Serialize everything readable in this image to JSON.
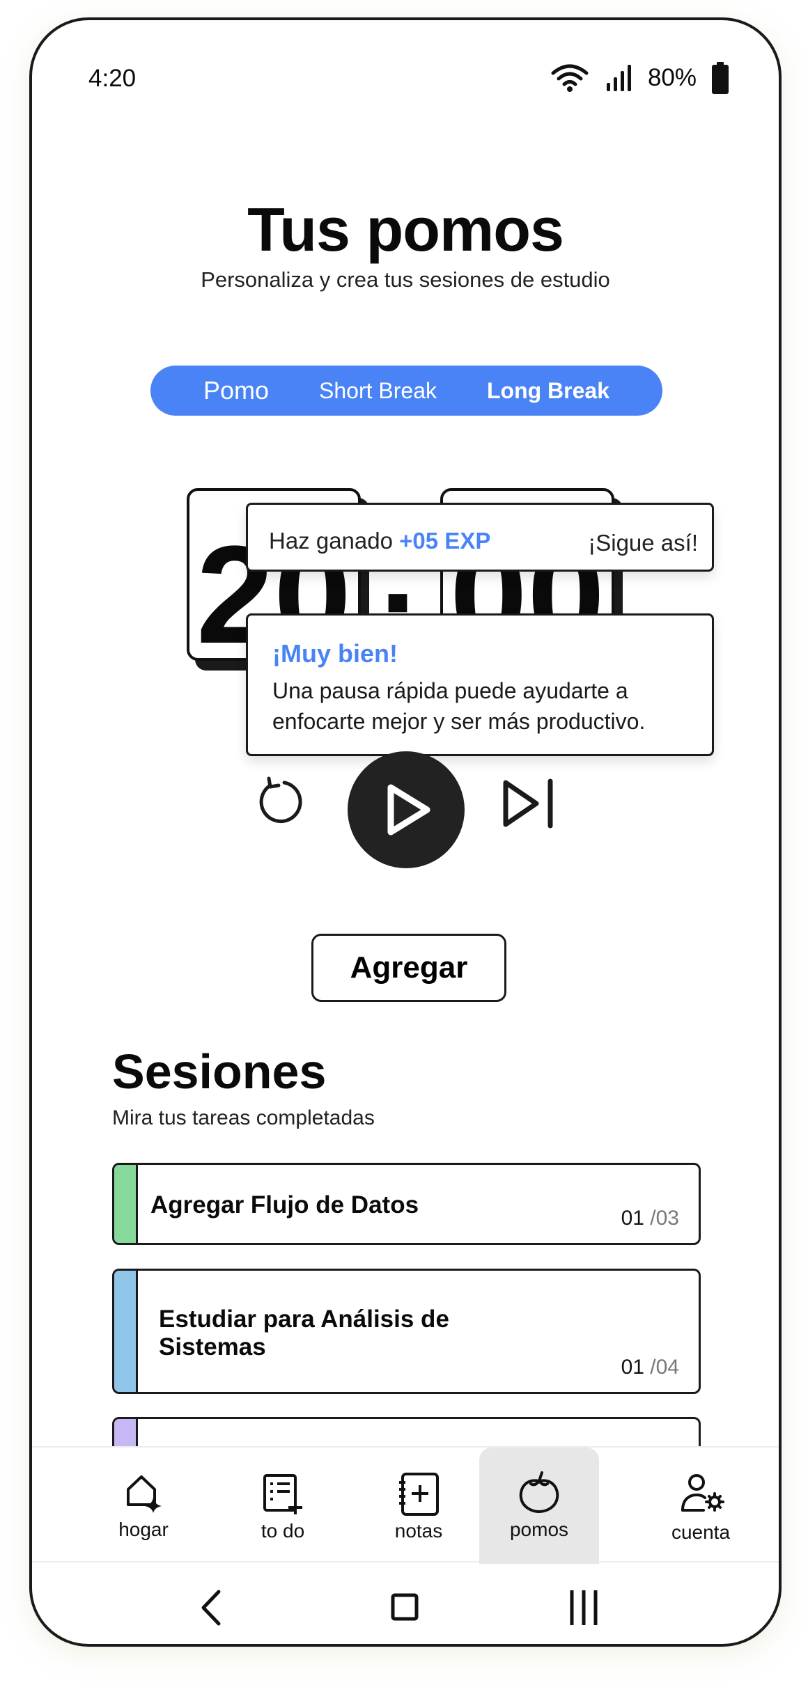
{
  "status_bar": {
    "time": "4:20",
    "battery": "80%"
  },
  "header": {
    "title": "Tus pomos",
    "subtitle": "Personaliza y crea tus sesiones de estudio"
  },
  "mode_tabs": [
    {
      "label": "Pomo"
    },
    {
      "label": "Short Break"
    },
    {
      "label": "Long Break"
    }
  ],
  "timer": {
    "minutes": "20",
    "seconds": "00",
    "separator": ":"
  },
  "toast_exp": {
    "lead": "Haz ganado",
    "exp": "+05 EXP",
    "cheer": "¡Sigue así!"
  },
  "toast_tip": {
    "title": "¡Muy bien!",
    "body": "Una pausa rápida puede ayudarte a enfocarte mejor y ser más productivo."
  },
  "add_button": {
    "label": "Agregar"
  },
  "sessions": {
    "title": "Sesiones",
    "subtitle": "Mira tus tareas completadas",
    "items": [
      {
        "name": "Agregar Flujo de Datos",
        "done": "01",
        "total": "/03",
        "color": "#86d99a"
      },
      {
        "name": "Estudiar para Análisis de Sistemas",
        "done": "01",
        "total": "/04",
        "color": "#8ec5e8"
      },
      {
        "name": "",
        "done": "",
        "total": "",
        "color": "#c7b8f5"
      }
    ]
  },
  "bottom_nav": [
    {
      "label": "hogar",
      "icon": "home-sparkle-icon"
    },
    {
      "label": "to do",
      "icon": "checklist-add-icon"
    },
    {
      "label": "notas",
      "icon": "notebook-add-icon"
    },
    {
      "label": "pomos",
      "icon": "tomato-icon",
      "active": true
    },
    {
      "label": "cuenta",
      "icon": "user-settings-icon"
    }
  ],
  "colors": {
    "accent": "#4a83f6",
    "play_button": "#222222"
  }
}
